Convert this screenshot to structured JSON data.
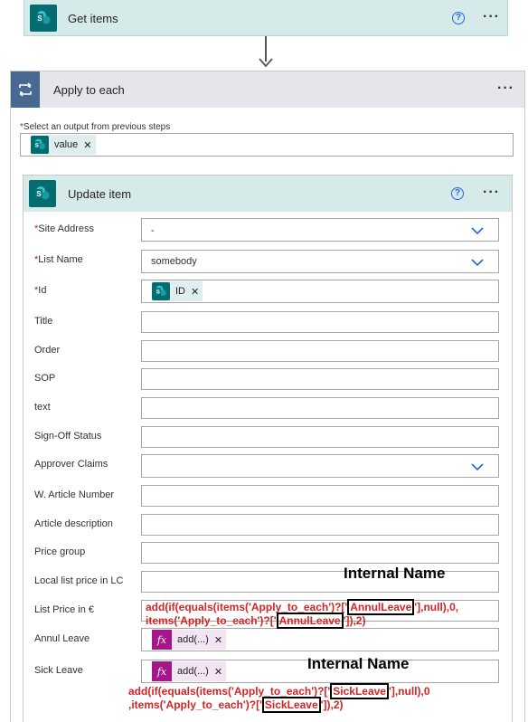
{
  "get_items": {
    "title": "Get items"
  },
  "apply_to_each": {
    "title": "Apply to each",
    "output_label": "Select an output from previous steps",
    "output_token": "value"
  },
  "update_item": {
    "title": "Update item",
    "fields": {
      "site_address": {
        "label": "Site Address",
        "value": "-"
      },
      "list_name": {
        "label": "List Name",
        "value": "somebody"
      },
      "id": {
        "label": "Id",
        "token": "ID"
      },
      "title": {
        "label": "Title"
      },
      "order": {
        "label": "Order"
      },
      "sop": {
        "label": "SOP"
      },
      "text": {
        "label": "text"
      },
      "sign_off": {
        "label": "Sign-Off Status"
      },
      "approver": {
        "label": "Approver Claims"
      },
      "w_article": {
        "label": "W. Article Number"
      },
      "article_desc": {
        "label": "Article description"
      },
      "price_group": {
        "label": "Price group"
      },
      "local_price": {
        "label": "Local list price in LC"
      },
      "list_price": {
        "label": "List Price in €"
      },
      "annul_leave": {
        "label": "Annul Leave",
        "token": "add(...)"
      },
      "sick_leave": {
        "label": "Sick Leave",
        "token": "add(...)"
      }
    }
  },
  "annotations": {
    "internal_name_1": "Internal Name",
    "internal_name_2": "Internal Name",
    "annul": {
      "p1": "add(if(equals(items('Apply_to_each')?['",
      "k1": "AnnulLeave",
      "p2": "'],null),0,",
      "p3": "items('Apply_to_each')?['",
      "k2": "AnnulLeave",
      "p4": "']),2)"
    },
    "sick": {
      "p1": "add(if(equals(items('Apply_to_each')?['",
      "k1": "SickLeave",
      "p2": "'],null),0",
      "p3": ",items('Apply_to_each')?['",
      "k2": "SickLeave",
      "p4": "']),2)"
    }
  },
  "colors": {
    "sharepoint": "#036c70",
    "loop": "#486991",
    "expression": "#a6168a",
    "annotation": "#d42424"
  }
}
